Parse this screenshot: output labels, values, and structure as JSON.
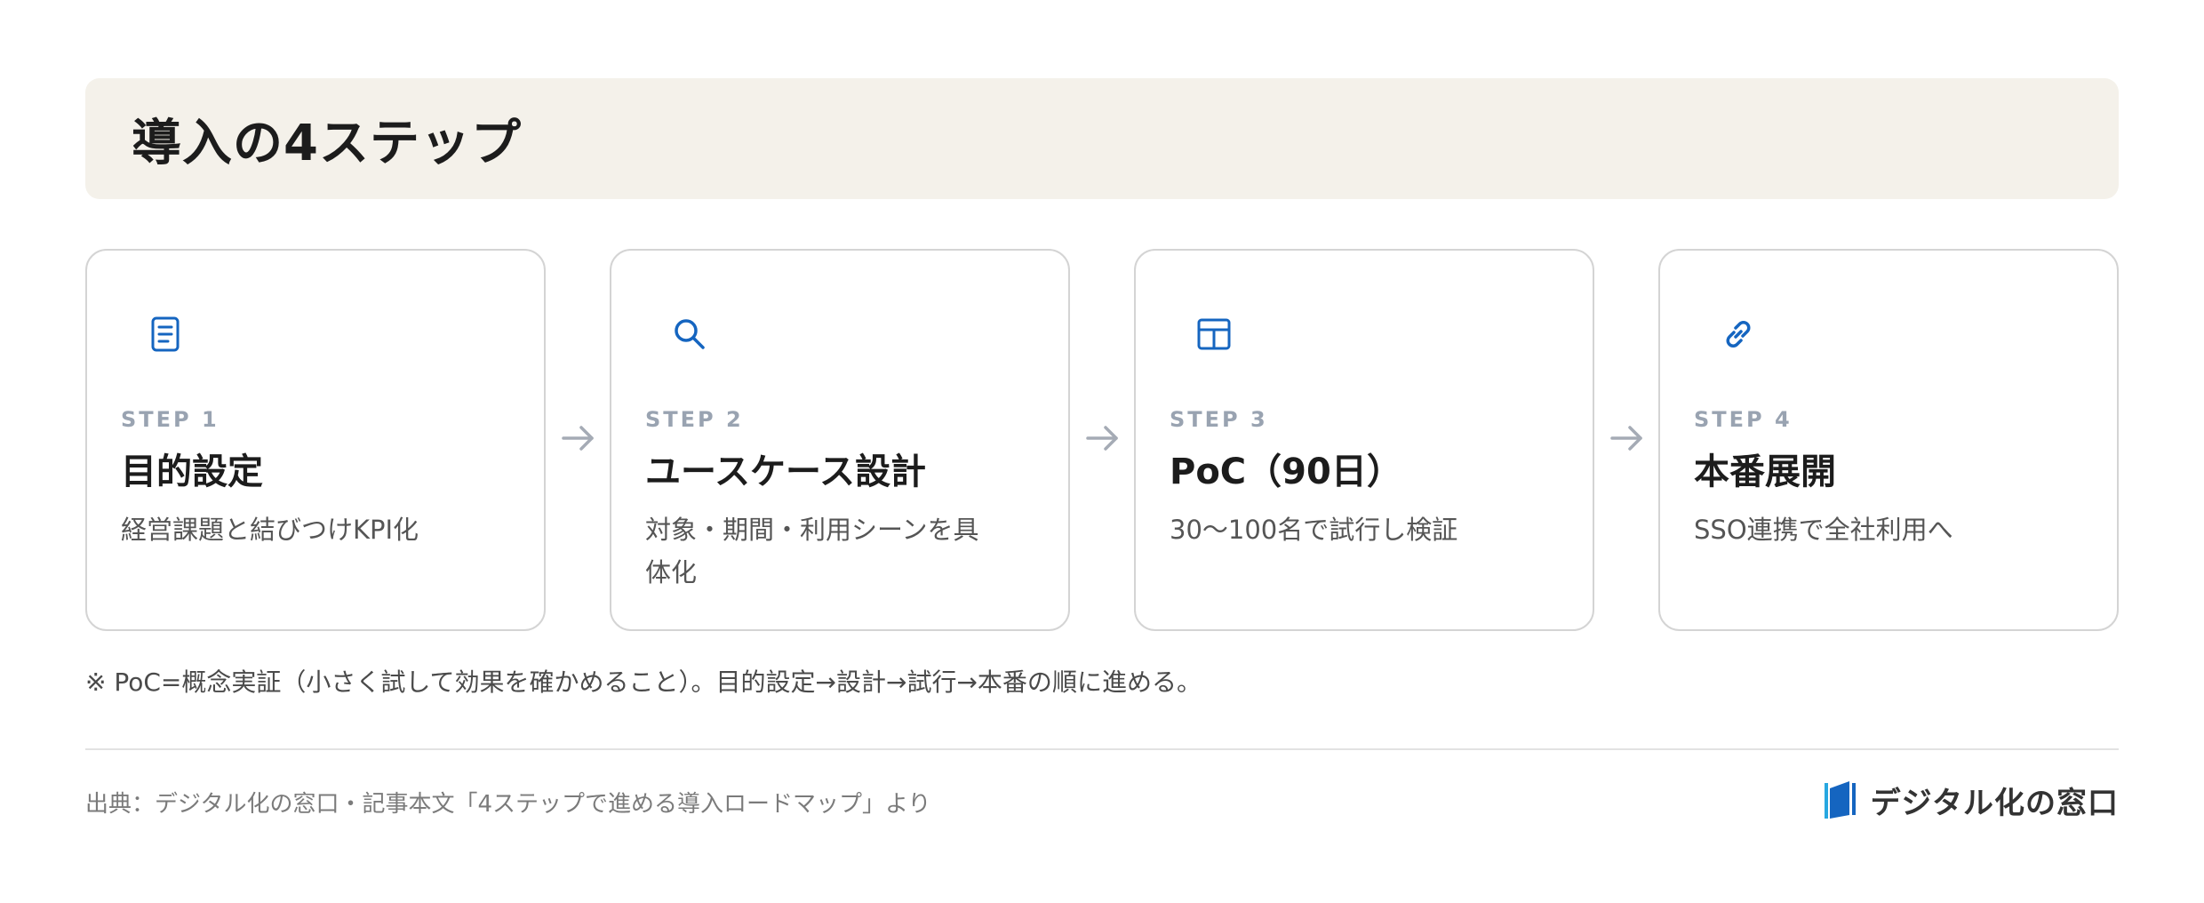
{
  "header": {
    "title": "導入の4ステップ"
  },
  "colors": {
    "accent": "#1565c0",
    "step_label": "#99a3b1",
    "header_bg": "#f4f1ea",
    "arrow": "#a5abb5"
  },
  "steps": [
    {
      "icon": "document-icon",
      "label": "STEP 1",
      "title": "目的設定",
      "description": "経営課題と結びつけKPI化"
    },
    {
      "icon": "search-icon",
      "label": "STEP 2",
      "title": "ユースケース設計",
      "description": "対象・期間・利用シーンを具体化"
    },
    {
      "icon": "table-icon",
      "label": "STEP 3",
      "title": "PoC（90日）",
      "description": "30〜100名で試行し検証"
    },
    {
      "icon": "link-icon",
      "label": "STEP 4",
      "title": "本番展開",
      "description": "SSO連携で全社利用へ"
    }
  ],
  "footnote": "※ PoC=概念実証（小さく試して効果を確かめること）。目的設定→設計→試行→本番の順に進める。",
  "footer": {
    "source": "出典：デジタル化の窓口・記事本文「4ステップで進める導入ロードマップ」より",
    "brand": "デジタル化の窓口"
  }
}
